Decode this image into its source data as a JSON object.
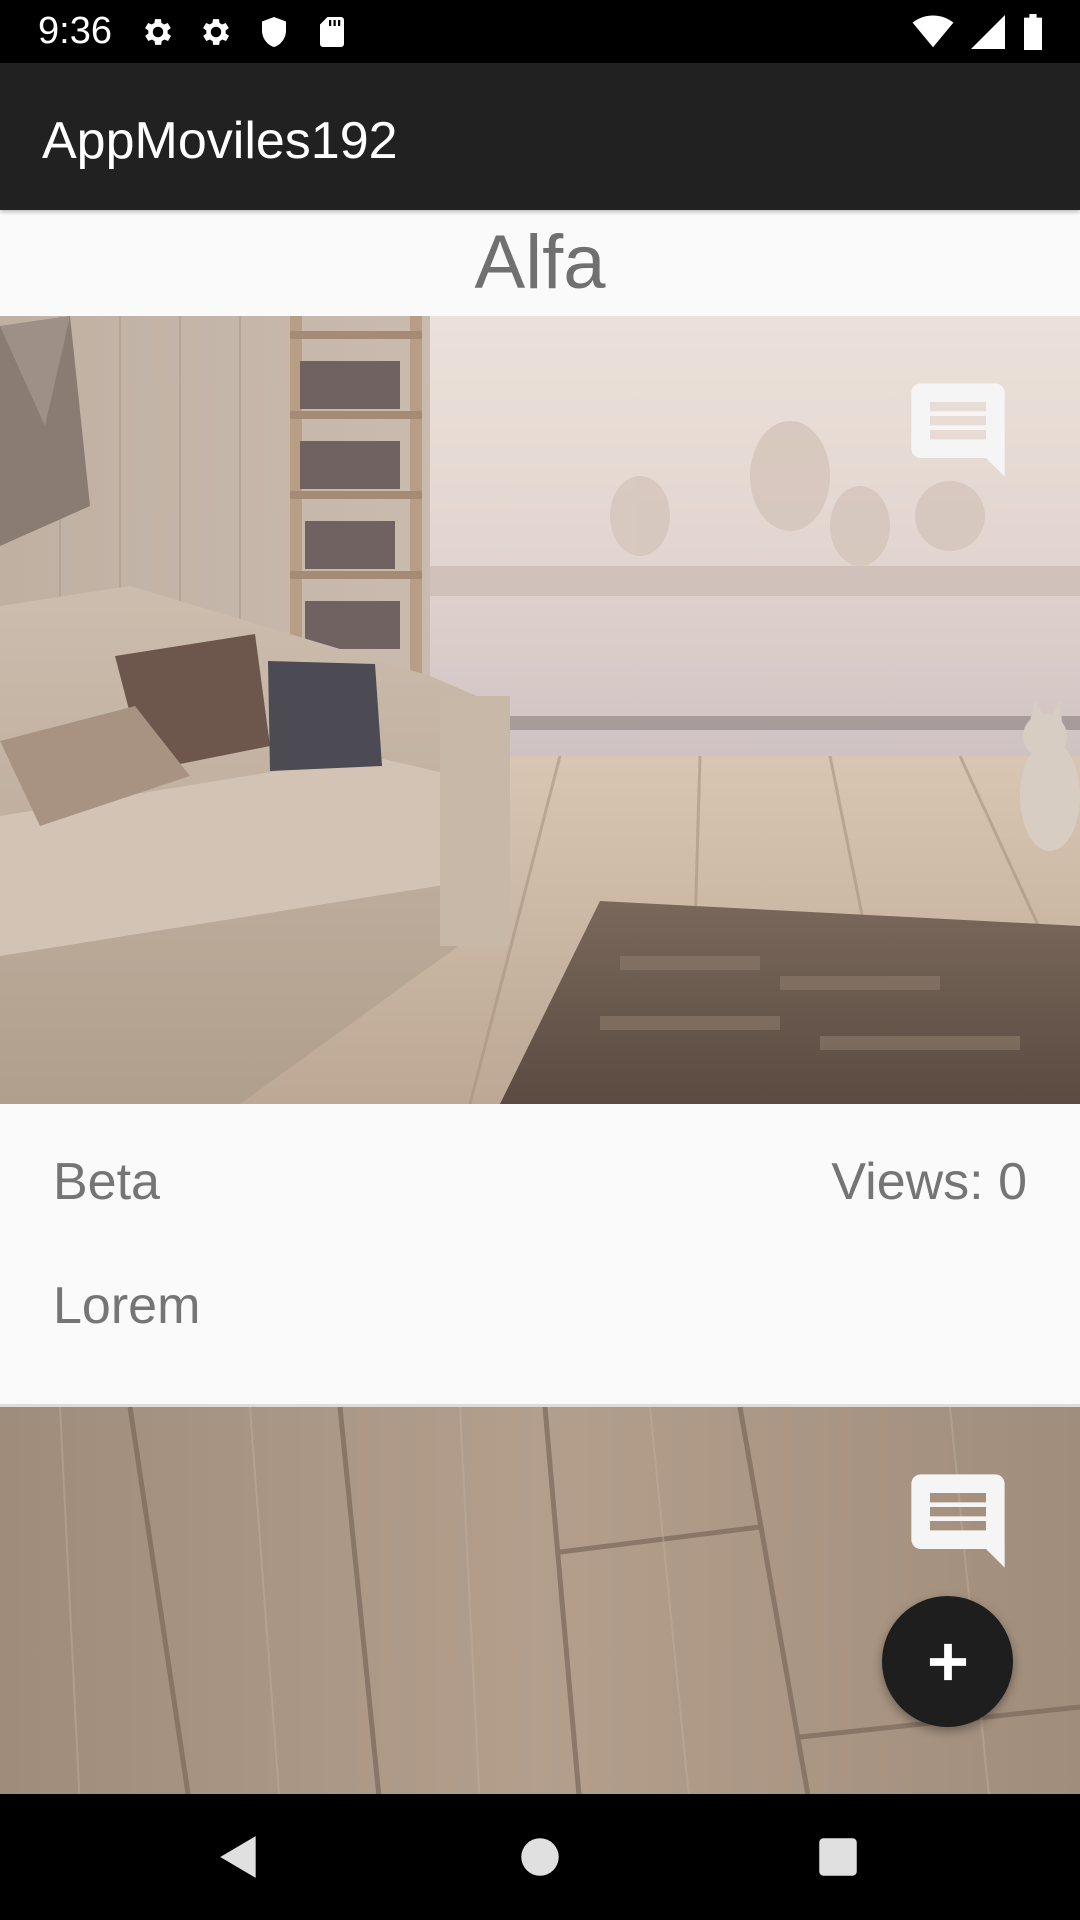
{
  "status_bar": {
    "time": "9:36",
    "left_icons": [
      "gear-icon",
      "gear-icon",
      "shield-icon",
      "sd-card-icon"
    ],
    "right_icons": [
      "wifi-icon",
      "signal-icon",
      "battery-icon"
    ]
  },
  "app_bar": {
    "title": "AppMoviles192"
  },
  "cards": [
    {
      "title": "Alfa",
      "image": "living-room-photo",
      "subtitle": "Beta",
      "views": "Views: 0",
      "description": "Lorem",
      "comment_icon": "comment-icon"
    },
    {
      "image": "wood-floor-photo",
      "comment_icon": "comment-icon"
    }
  ],
  "fab": {
    "icon": "plus-icon"
  },
  "nav_bar": {
    "buttons": [
      "back-icon",
      "home-icon",
      "recents-icon"
    ]
  },
  "colors": {
    "status_bar": "#000000",
    "app_bar": "#212121",
    "background": "#fafafa",
    "text_secondary": "#757575",
    "fab": "#1e1e1e"
  }
}
